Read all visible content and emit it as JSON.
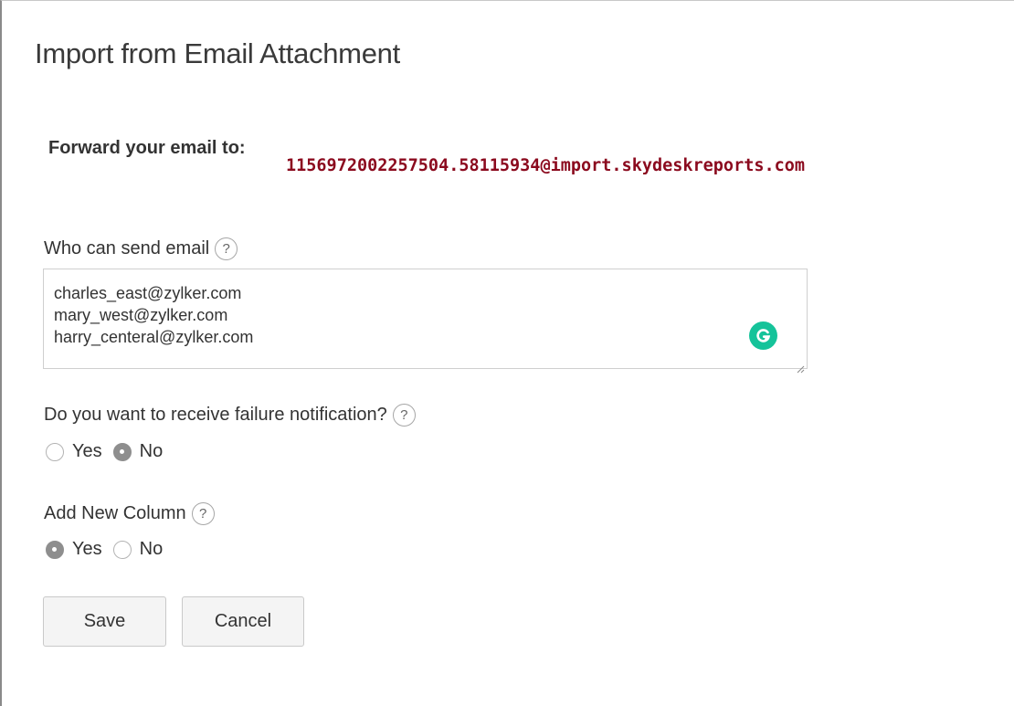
{
  "dialog": {
    "title": "Import from Email Attachment"
  },
  "forward": {
    "label": "Forward your email to:",
    "address": "1156972002257504.58115934@import.skydeskreports.com"
  },
  "senders": {
    "label": "Who can send email",
    "emails": [
      "charles_east@zylker.com",
      "mary_west@zylker.com",
      "harry_centeral@zylker.com"
    ]
  },
  "failure_notification": {
    "label": "Do you want to receive failure notification?",
    "options": [
      "Yes",
      "No"
    ],
    "selected": "No"
  },
  "add_new_column": {
    "label": "Add New Column",
    "options": [
      "Yes",
      "No"
    ],
    "selected": "Yes"
  },
  "help_glyph": "?",
  "buttons": {
    "save": "Save",
    "cancel": "Cancel"
  },
  "colors": {
    "address": "#8b0a1e",
    "grammarly": "#15c39a",
    "radio_checked": "#8e8e8e"
  },
  "icons": [
    "help-icon",
    "grammarly-icon",
    "resize-grip-icon"
  ]
}
